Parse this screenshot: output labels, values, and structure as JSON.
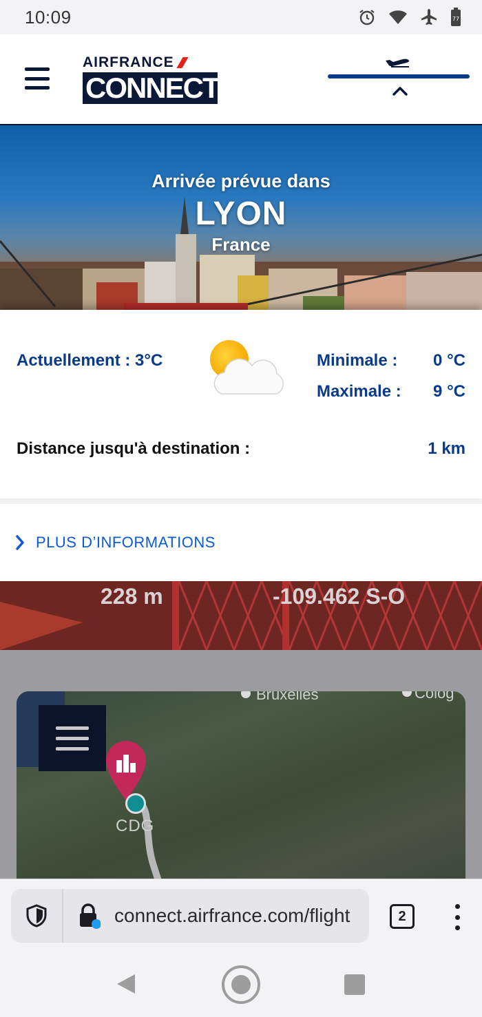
{
  "status_bar": {
    "time": "10:09",
    "icons": [
      "alarm-icon",
      "wifi-icon",
      "airplane-mode-icon",
      "battery-icon"
    ],
    "battery_level": "77"
  },
  "header": {
    "logo_line1": "AIRFRANCE",
    "logo_line2": "CONNECT",
    "progress_icon": "plane-landing-icon"
  },
  "hero": {
    "subtitle": "Arrivée prévue dans",
    "city": "LYON",
    "country": "France"
  },
  "weather": {
    "current_label": "Actuellement : 3°C",
    "weather_icon": "partly-cloudy-icon",
    "min_label": "Minimale :",
    "min_value": "0 °C",
    "max_label": "Maximale :",
    "max_value": "9 °C",
    "distance_label": "Distance jusqu'à destination :",
    "distance_value": "1 km"
  },
  "more_info": {
    "label": "PLUS D’INFORMATIONS"
  },
  "flight_stats": {
    "altitude": "228 m",
    "heading": "-109.462 S-O"
  },
  "map": {
    "city_labels": [
      "Bruxelles",
      "Colog"
    ],
    "airport": "CDG"
  },
  "browser": {
    "url": "connect.airfrance.com/flight",
    "tab_count": "2"
  },
  "colors": {
    "brand_navy": "#0a1837",
    "brand_blue": "#0a3a8a",
    "link_blue": "#0b5bd3",
    "brand_red": "#e2231a"
  }
}
